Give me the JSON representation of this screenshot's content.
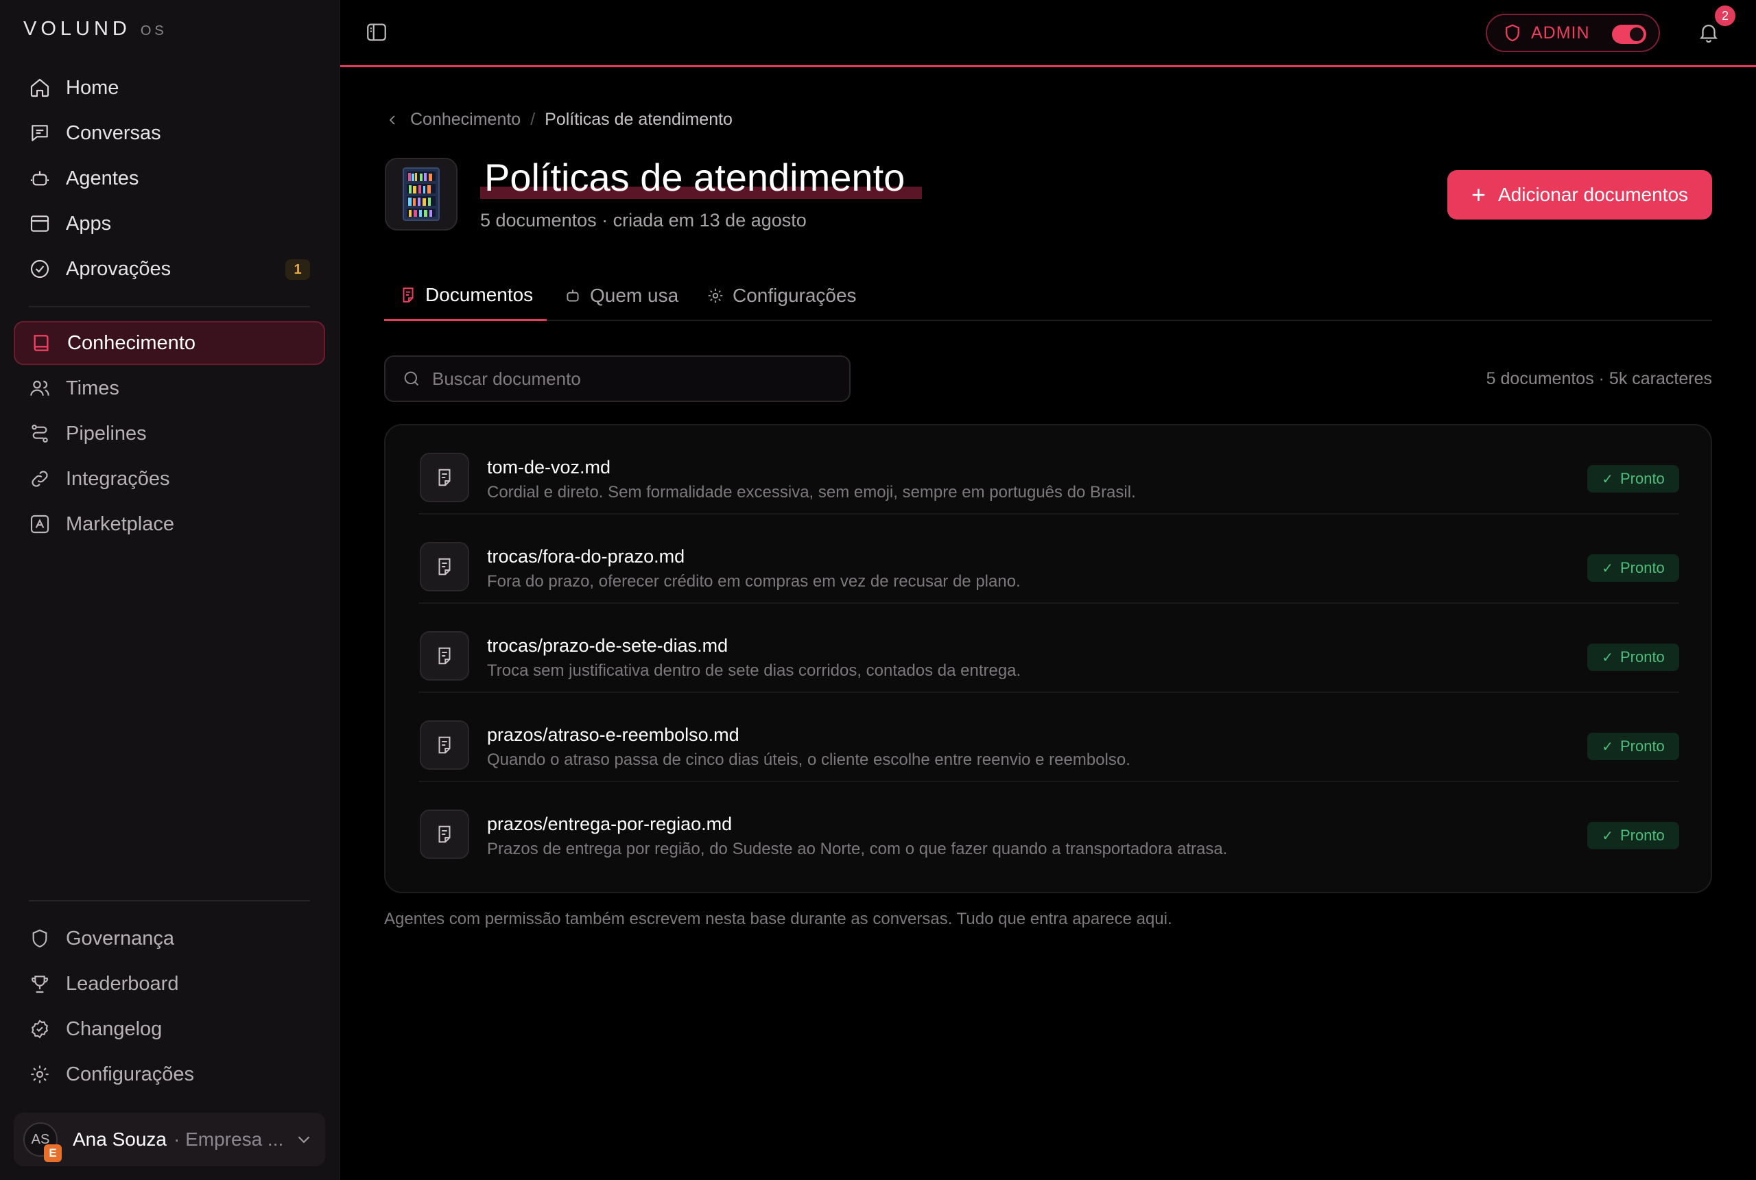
{
  "app": {
    "logo": "VOLUND",
    "logo_suffix": "OS"
  },
  "sidebar": {
    "primary": [
      {
        "label": "Home",
        "icon": "home-icon"
      },
      {
        "label": "Conversas",
        "icon": "chat-icon"
      },
      {
        "label": "Agentes",
        "icon": "bot-icon"
      },
      {
        "label": "Apps",
        "icon": "app-window-icon"
      },
      {
        "label": "Aprovações",
        "icon": "check-circle-icon",
        "badge": "1"
      }
    ],
    "secondary": [
      {
        "label": "Conhecimento",
        "icon": "book-icon",
        "active": true
      },
      {
        "label": "Times",
        "icon": "users-icon"
      },
      {
        "label": "Pipelines",
        "icon": "pipeline-icon"
      },
      {
        "label": "Integrações",
        "icon": "link-icon"
      },
      {
        "label": "Marketplace",
        "icon": "store-icon"
      }
    ],
    "bottom": [
      {
        "label": "Governança",
        "icon": "shield-icon"
      },
      {
        "label": "Leaderboard",
        "icon": "trophy-icon"
      },
      {
        "label": "Changelog",
        "icon": "badge-check-icon"
      },
      {
        "label": "Configurações",
        "icon": "gear-icon"
      }
    ],
    "user": {
      "initials": "AS",
      "org_badge": "E",
      "name": "Ana Souza",
      "company": "· Empresa ..."
    }
  },
  "topbar": {
    "admin_label": "ADMIN",
    "admin_enabled": true,
    "notifications": "2"
  },
  "breadcrumb": {
    "parent": "Conhecimento",
    "separator": "/",
    "current": "Políticas de atendimento"
  },
  "header": {
    "title": "Políticas de atendimento",
    "subtitle": "5 documentos · criada em 13 de agosto",
    "add_button": "Adicionar documentos"
  },
  "tabs": [
    {
      "label": "Documentos",
      "icon": "document-icon",
      "active": true
    },
    {
      "label": "Quem usa",
      "icon": "bot-icon"
    },
    {
      "label": "Configurações",
      "icon": "gear-icon"
    }
  ],
  "search": {
    "placeholder": "Buscar documento",
    "value": ""
  },
  "stats": "5 documentos · 5k caracteres",
  "documents": [
    {
      "name": "tom-de-voz.md",
      "description": "Cordial e direto. Sem formalidade excessiva, sem emoji, sempre em português do Brasil.",
      "status": "Pronto"
    },
    {
      "name": "trocas/fora-do-prazo.md",
      "description": "Fora do prazo, oferecer crédito em compras em vez de recusar de plano.",
      "status": "Pronto"
    },
    {
      "name": "trocas/prazo-de-sete-dias.md",
      "description": "Troca sem justificativa dentro de sete dias corridos, contados da entrega.",
      "status": "Pronto"
    },
    {
      "name": "prazos/atraso-e-reembolso.md",
      "description": "Quando o atraso passa de cinco dias úteis, o cliente escolhe entre reenvio e reembolso.",
      "status": "Pronto"
    },
    {
      "name": "prazos/entrega-por-regiao.md",
      "description": "Prazos de entrega por região, do Sudeste ao Norte, com o que fazer quando a transportadora atrasa.",
      "status": "Pronto"
    }
  ],
  "footnote": "Agentes com permissão também escrevem nesta base durante as conversas. Tudo que entra aparece aqui.",
  "colors": {
    "accent": "#e93a5c",
    "background": "#000000",
    "sidebar": "#141114",
    "success": "#4fbf7b"
  }
}
